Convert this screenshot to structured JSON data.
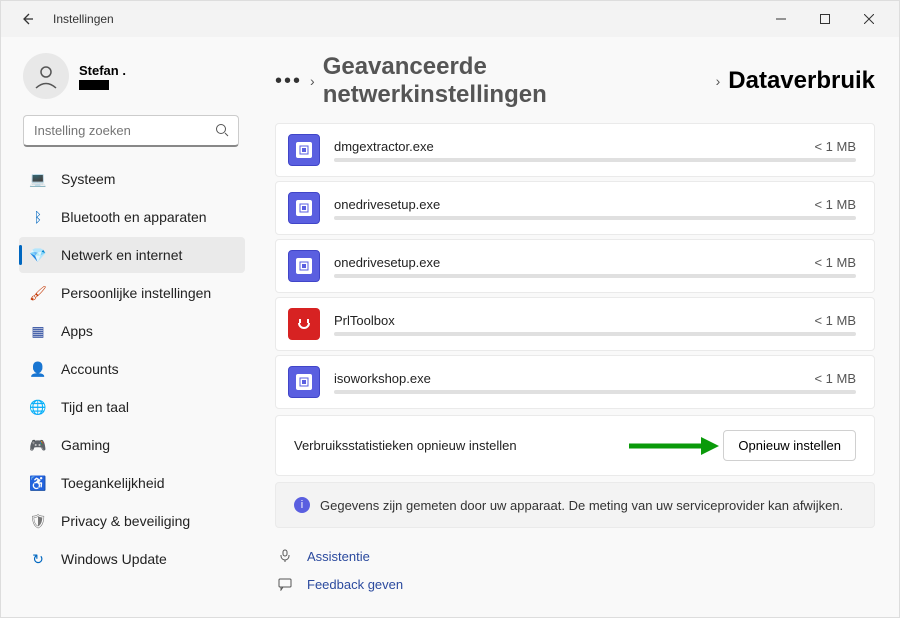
{
  "titlebar": {
    "title": "Instellingen"
  },
  "user": {
    "name": "Stefan ."
  },
  "search": {
    "placeholder": "Instelling zoeken"
  },
  "sidebar": {
    "items": [
      {
        "label": "Systeem",
        "icon": "💻",
        "color": "#0067c0"
      },
      {
        "label": "Bluetooth en apparaten",
        "icon": "ᛒ",
        "color": "#0067c0"
      },
      {
        "label": "Netwerk en internet",
        "icon": "💎",
        "color": "#10893e",
        "active": true
      },
      {
        "label": "Persoonlijke instellingen",
        "icon": "🖌",
        "color": "#c43500"
      },
      {
        "label": "Apps",
        "icon": "▦",
        "color": "#2b4a9e"
      },
      {
        "label": "Accounts",
        "icon": "👤",
        "color": "#10893e"
      },
      {
        "label": "Tijd en taal",
        "icon": "🌐",
        "color": "#0067c0"
      },
      {
        "label": "Gaming",
        "icon": "🎮",
        "color": "#777"
      },
      {
        "label": "Toegankelijkheid",
        "icon": "♿",
        "color": "#0067c0"
      },
      {
        "label": "Privacy & beveiliging",
        "icon": "🛡",
        "color": "#777"
      },
      {
        "label": "Windows Update",
        "icon": "↻",
        "color": "#0067c0"
      }
    ]
  },
  "breadcrumb": {
    "parent": "Geavanceerde netwerkinstellingen",
    "current": "Dataverbruik"
  },
  "apps": [
    {
      "name": "dmgextractor.exe",
      "size": "< 1 MB",
      "iconType": "blue"
    },
    {
      "name": "onedrivesetup.exe",
      "size": "< 1 MB",
      "iconType": "blue"
    },
    {
      "name": "onedrivesetup.exe",
      "size": "< 1 MB",
      "iconType": "blue"
    },
    {
      "name": "PrlToolbox",
      "size": "< 1 MB",
      "iconType": "red"
    },
    {
      "name": "isoworkshop.exe",
      "size": "< 1 MB",
      "iconType": "blue"
    }
  ],
  "reset": {
    "label": "Verbruiksstatistieken opnieuw instellen",
    "button": "Opnieuw instellen"
  },
  "info": {
    "text": "Gegevens zijn gemeten door uw apparaat. De meting van uw serviceprovider kan afwijken."
  },
  "footer": {
    "help": "Assistentie",
    "feedback": "Feedback geven"
  }
}
